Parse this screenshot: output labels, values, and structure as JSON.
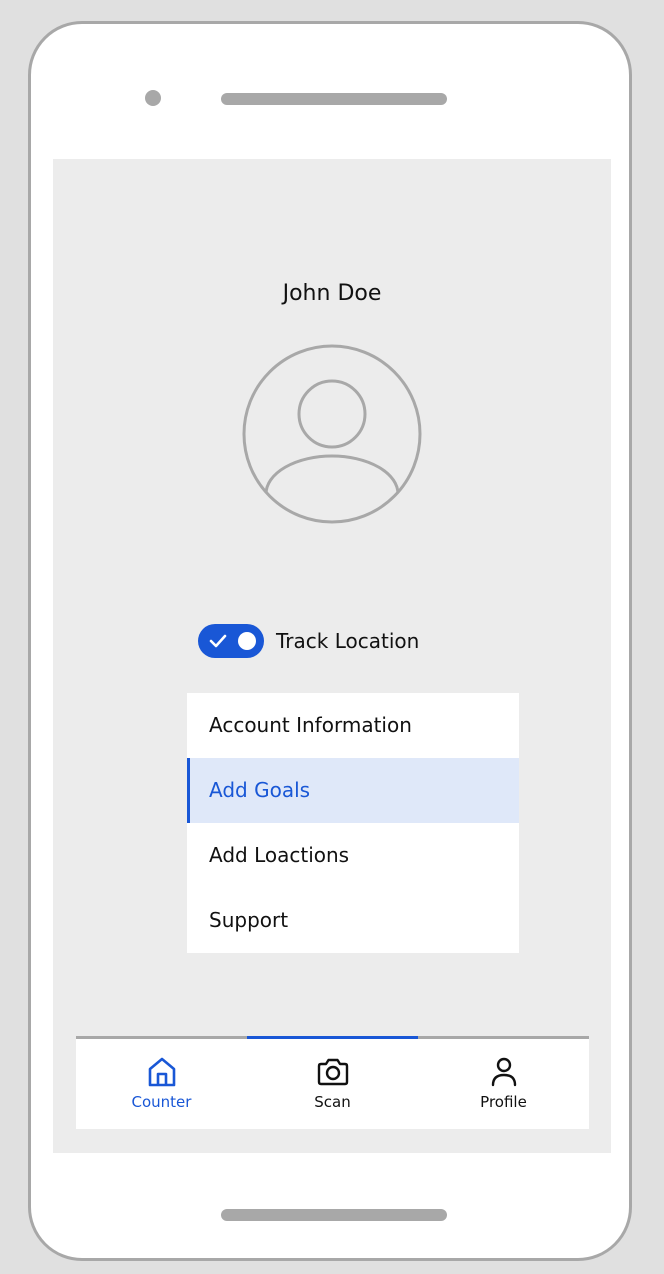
{
  "profile": {
    "name": "John Doe",
    "avatar_icon": "user-avatar-icon"
  },
  "track_location": {
    "label": "Track Location",
    "enabled": true
  },
  "menu": {
    "items": [
      {
        "label": "Account Information",
        "active": false
      },
      {
        "label": "Add Goals",
        "active": true
      },
      {
        "label": "Add Loactions",
        "active": false
      },
      {
        "label": "Support",
        "active": false
      }
    ]
  },
  "bottom_nav": {
    "items": [
      {
        "label": "Counter",
        "icon": "home-icon",
        "active": true
      },
      {
        "label": "Scan",
        "icon": "camera-icon",
        "active": false
      },
      {
        "label": "Profile",
        "icon": "person-icon",
        "active": false
      }
    ]
  },
  "colors": {
    "accent": "#1957d6",
    "highlight": "#dfe8f9",
    "screen_bg": "#ececec",
    "frame": "#a8a8a8"
  }
}
